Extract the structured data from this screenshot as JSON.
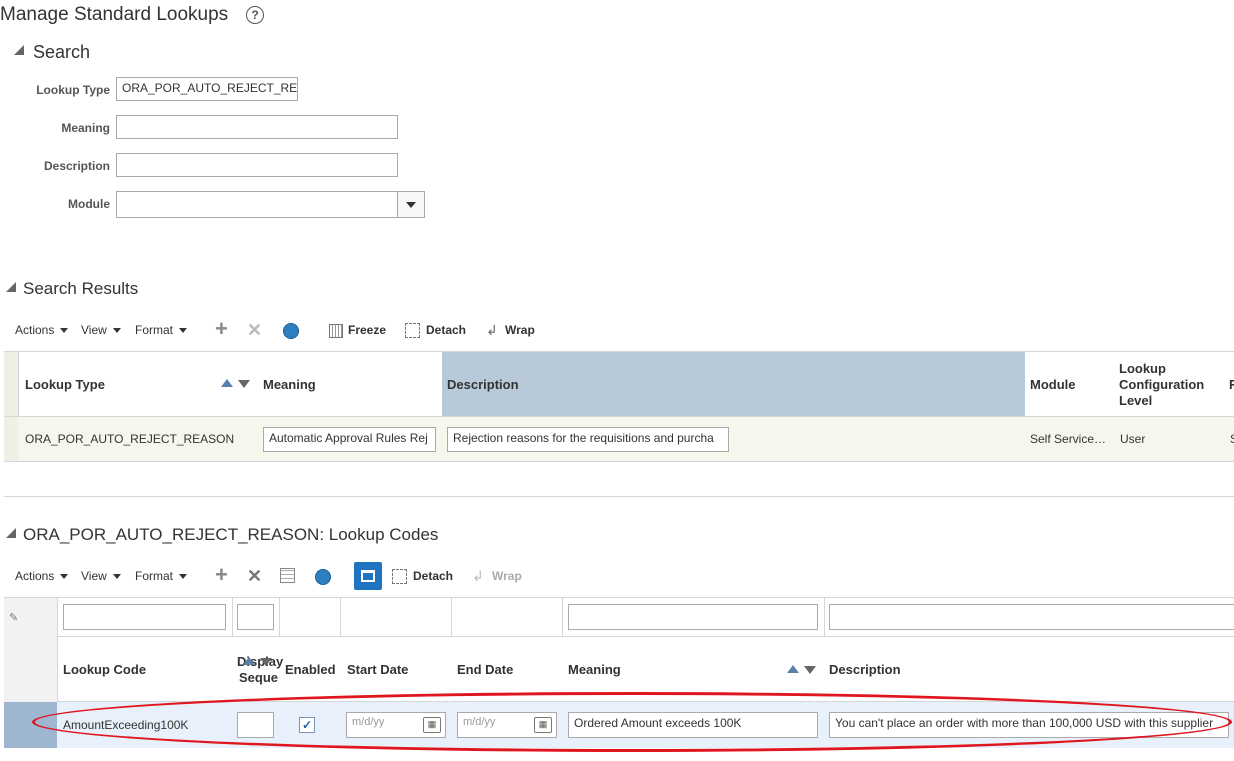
{
  "page": {
    "title": "Manage Standard Lookups",
    "help_icon": "help-icon"
  },
  "search": {
    "title": "Search",
    "fields": {
      "lookup_type": {
        "label": "Lookup Type",
        "value": "ORA_POR_AUTO_REJECT_RE"
      },
      "meaning": {
        "label": "Meaning",
        "value": ""
      },
      "description": {
        "label": "Description",
        "value": ""
      },
      "module": {
        "label": "Module",
        "value": ""
      }
    }
  },
  "results": {
    "title": "Search Results",
    "toolbar": {
      "actions": "Actions",
      "view": "View",
      "format": "Format",
      "freeze": "Freeze",
      "detach": "Detach",
      "wrap": "Wrap"
    },
    "columns": {
      "lookup_type": "Lookup Type",
      "meaning": "Meaning",
      "description": "Description",
      "module": "Module",
      "config_level": "Lookup Configuration Level"
    },
    "config_level_lines": [
      "Lookup",
      "Configuration",
      "Level"
    ],
    "rows": [
      {
        "lookup_type": "ORA_POR_AUTO_REJECT_REASON",
        "meaning": "Automatic Approval Rules Rej",
        "description": "Rejection reasons for the requisitions and purcha",
        "module": "Self Service…",
        "config_level": "User",
        "extra": "S"
      }
    ],
    "clipped_header": "F"
  },
  "codes": {
    "title": "ORA_POR_AUTO_REJECT_REASON: Lookup Codes",
    "toolbar": {
      "actions": "Actions",
      "view": "View",
      "format": "Format",
      "detach": "Detach",
      "wrap": "Wrap"
    },
    "columns": {
      "lookup_code": "Lookup Code",
      "display_seq_1": "Display",
      "display_seq_2": "Seque",
      "enabled": "Enabled",
      "start_date": "Start Date",
      "end_date": "End Date",
      "meaning": "Meaning",
      "description": "Description"
    },
    "rows": [
      {
        "lookup_code": "AmountExceeding100K",
        "display_seq": "",
        "enabled": true,
        "start_date_placeholder": "m/d/yy",
        "end_date_placeholder": "m/d/yy",
        "meaning": "Ordered Amount exceeds 100K",
        "description": "You can't place an order with more than 100,000 USD with this supplier"
      }
    ]
  },
  "colors": {
    "highlight_header": "#b8c9d9",
    "selected_row": "#e8f1fb",
    "result_row": "#f6f7ec",
    "annotation": "#e0161f",
    "accent_button": "#1f73c0"
  }
}
